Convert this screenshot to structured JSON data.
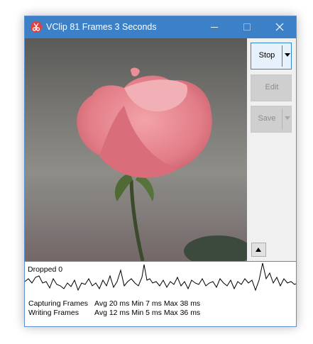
{
  "window": {
    "title": "VClip 81 Frames 3 Seconds",
    "controls": [
      "minimize-icon",
      "maximize-icon",
      "close-icon"
    ],
    "accent_color": "#3c80c8"
  },
  "video": {
    "subject": "pink rose"
  },
  "side_panel": {
    "stop_label": "Stop",
    "edit_label": "Edit",
    "save_label": "Save"
  },
  "graph": {
    "dropped_label": "Dropped 0"
  },
  "stats": {
    "rows": [
      {
        "label": "Capturing Frames",
        "value": "Avg 20 ms Min 7 ms Max 38 ms"
      },
      {
        "label": "Writing Frames",
        "value": "Avg 12 ms Min 5 ms Max 36 ms"
      }
    ]
  }
}
